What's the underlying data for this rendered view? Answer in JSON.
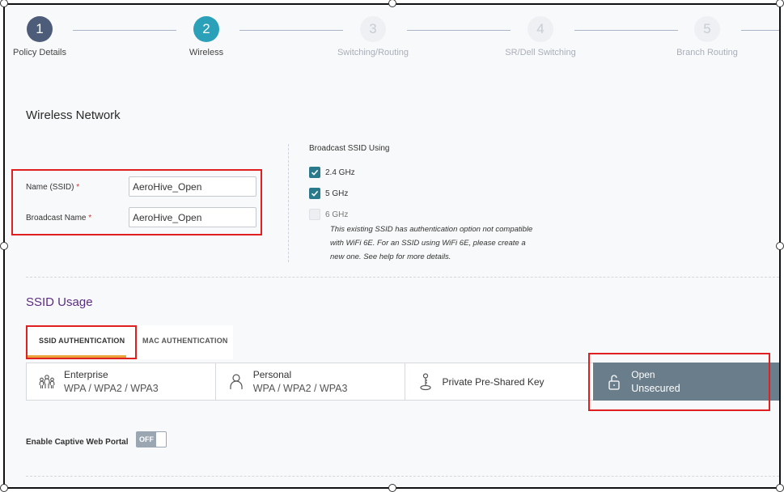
{
  "stepper": {
    "steps": [
      {
        "num": "1",
        "label": "Policy Details",
        "state": "done"
      },
      {
        "num": "2",
        "label": "Wireless",
        "state": "active"
      },
      {
        "num": "3",
        "label": "Switching/Routing",
        "state": "pending"
      },
      {
        "num": "4",
        "label": "SR/Dell Switching",
        "state": "pending"
      },
      {
        "num": "5",
        "label": "Branch Routing",
        "state": "pending"
      }
    ]
  },
  "wireless": {
    "title": "Wireless Network",
    "name_label": "Name (SSID)",
    "name_value": "AeroHive_Open",
    "broadcast_label": "Broadcast Name",
    "broadcast_value": "AeroHive_Open",
    "required_mark": "*",
    "broadcast_using_label": "Broadcast SSID Using",
    "bands": [
      {
        "label": "2.4 GHz",
        "checked": true
      },
      {
        "label": "5 GHz",
        "checked": true
      },
      {
        "label": "6 GHz",
        "checked": false
      }
    ],
    "note": "This existing SSID has authentication option not compatible with WiFi 6E. For an SSID using WiFi 6E, please create a new one. See help for more details."
  },
  "ssid_usage": {
    "title": "SSID Usage",
    "tabs": [
      {
        "label": "SSID AUTHENTICATION",
        "active": true
      },
      {
        "label": "MAC AUTHENTICATION",
        "active": false
      }
    ],
    "auth_options": [
      {
        "title": "Enterprise",
        "subtitle": "WPA / WPA2 / WPA3",
        "icon": "enterprise-users-icon",
        "selected": false
      },
      {
        "title": "Personal",
        "subtitle": "WPA / WPA2 / WPA3",
        "icon": "person-icon",
        "selected": false
      },
      {
        "title": "Private Pre-Shared Key",
        "subtitle": "",
        "icon": "key-icon",
        "selected": false
      },
      {
        "title": "Open",
        "subtitle": "Unsecured",
        "icon": "unlock-icon",
        "selected": true
      }
    ]
  },
  "captive_portal": {
    "label": "Enable Captive Web Portal",
    "toggle_text": "OFF"
  },
  "colors": {
    "accent": "#2aa1b8",
    "done_step": "#4d5c78",
    "selected_card": "#6a7d8b",
    "tab_underline": "#e8a33a",
    "usage_title": "#5b2d82",
    "highlight": "#e02020"
  }
}
